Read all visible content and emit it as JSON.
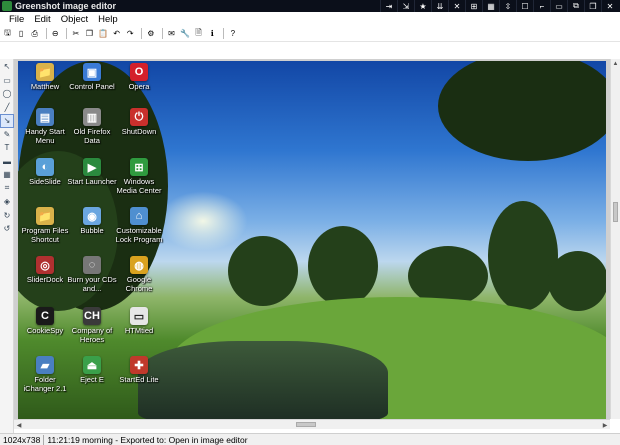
{
  "window": {
    "title": "Greenshot image editor",
    "caption_buttons": [
      "⇥",
      "⇲",
      "★",
      "⇊",
      "✕",
      "⊞",
      "▦",
      "⇳",
      "☐",
      "⌐",
      "▭",
      "⧉",
      "❐",
      "✕"
    ]
  },
  "menu": {
    "items": [
      "File",
      "Edit",
      "Object",
      "Help"
    ]
  },
  "toolbar": {
    "tools": [
      {
        "name": "save-icon",
        "glyph": "🖫"
      },
      {
        "name": "copy-icon",
        "glyph": "▯"
      },
      {
        "name": "print-icon",
        "glyph": "⎙"
      },
      {
        "name": "sep",
        "glyph": ""
      },
      {
        "name": "delete-icon",
        "glyph": "⊖"
      },
      {
        "name": "sep",
        "glyph": ""
      },
      {
        "name": "cut-icon",
        "glyph": "✂"
      },
      {
        "name": "copy-clipboard-icon",
        "glyph": "❐"
      },
      {
        "name": "paste-icon",
        "glyph": "📋"
      },
      {
        "name": "undo-icon",
        "glyph": "↶"
      },
      {
        "name": "redo-icon",
        "glyph": "↷"
      },
      {
        "name": "sep",
        "glyph": ""
      },
      {
        "name": "settings-icon",
        "glyph": "⚙"
      },
      {
        "name": "sep",
        "glyph": ""
      },
      {
        "name": "email-icon",
        "glyph": "✉"
      },
      {
        "name": "tools-icon",
        "glyph": "🔧"
      },
      {
        "name": "export-icon",
        "glyph": "🗎"
      },
      {
        "name": "info-icon",
        "glyph": "ℹ"
      },
      {
        "name": "sep",
        "glyph": ""
      },
      {
        "name": "help-icon",
        "glyph": "?"
      }
    ]
  },
  "left_tools": [
    {
      "name": "select-tool-icon",
      "glyph": "↖"
    },
    {
      "name": "rectangle-tool-icon",
      "glyph": "▭"
    },
    {
      "name": "ellipse-tool-icon",
      "glyph": "◯"
    },
    {
      "name": "line-tool-icon",
      "glyph": "╱"
    },
    {
      "name": "arrow-tool-icon",
      "glyph": "↘"
    },
    {
      "name": "freehand-tool-icon",
      "glyph": "✎"
    },
    {
      "name": "text-tool-icon",
      "glyph": "T"
    },
    {
      "name": "highlight-tool-icon",
      "glyph": "▬"
    },
    {
      "name": "obfuscate-tool-icon",
      "glyph": "▦"
    },
    {
      "name": "crop-tool-icon",
      "glyph": "⌗"
    },
    {
      "name": "effects-tool-icon",
      "glyph": "◈"
    },
    {
      "name": "rotate-cw-icon",
      "glyph": "↻"
    },
    {
      "name": "rotate-ccw-icon",
      "glyph": "↺"
    }
  ],
  "desktop_icons": [
    {
      "label": "Matthew",
      "glyph": "📁",
      "color": "#d9b24a"
    },
    {
      "label": "Control Panel",
      "glyph": "▣",
      "color": "#3a7bd5"
    },
    {
      "label": "Opera",
      "glyph": "O",
      "color": "#d4202b"
    },
    {
      "label": "Handy Start Menu",
      "glyph": "▤",
      "color": "#4a7fc1"
    },
    {
      "label": "Old Firefox Data",
      "glyph": "▥",
      "color": "#8a8a8a"
    },
    {
      "label": "ShutDown",
      "glyph": "⏻",
      "color": "#c9302c"
    },
    {
      "label": "SideSlide",
      "glyph": "◐",
      "color": "#5aa0d8"
    },
    {
      "label": "Start Launcher",
      "glyph": "▶",
      "color": "#2b8a3e"
    },
    {
      "label": "Windows Media Center",
      "glyph": "⊞",
      "color": "#2f9b3f"
    },
    {
      "label": "Program Files Shortcut",
      "glyph": "📁",
      "color": "#d9b24a"
    },
    {
      "label": "Bubble",
      "glyph": "◉",
      "color": "#6aa6e0"
    },
    {
      "label": "Customizable Lock Program",
      "glyph": "⌂",
      "color": "#4f8fd0"
    },
    {
      "label": "SliderDock",
      "glyph": "◎",
      "color": "#b03030"
    },
    {
      "label": "Burn your CDs and...",
      "glyph": "◌",
      "color": "#777"
    },
    {
      "label": "Google Chrome",
      "glyph": "◍",
      "color": "#d9a21f"
    },
    {
      "label": "CookieSpy",
      "glyph": "C",
      "color": "#1a1a1a"
    },
    {
      "label": "Company of Heroes",
      "glyph": "CH",
      "color": "#3a3a3a"
    },
    {
      "label": "HTMtied",
      "glyph": "▭",
      "color": "#e6e6e6"
    },
    {
      "label": "Folder iChanger 2.1",
      "glyph": "▰",
      "color": "#4a7fc1"
    },
    {
      "label": "Eject E",
      "glyph": "⏏",
      "color": "#3aa04a"
    },
    {
      "label": "StartEd Lite",
      "glyph": "✚",
      "color": "#c0392b"
    }
  ],
  "status": {
    "dimensions": "1024x738",
    "message": "11:21:19 morning - Exported to: Open in image editor"
  }
}
